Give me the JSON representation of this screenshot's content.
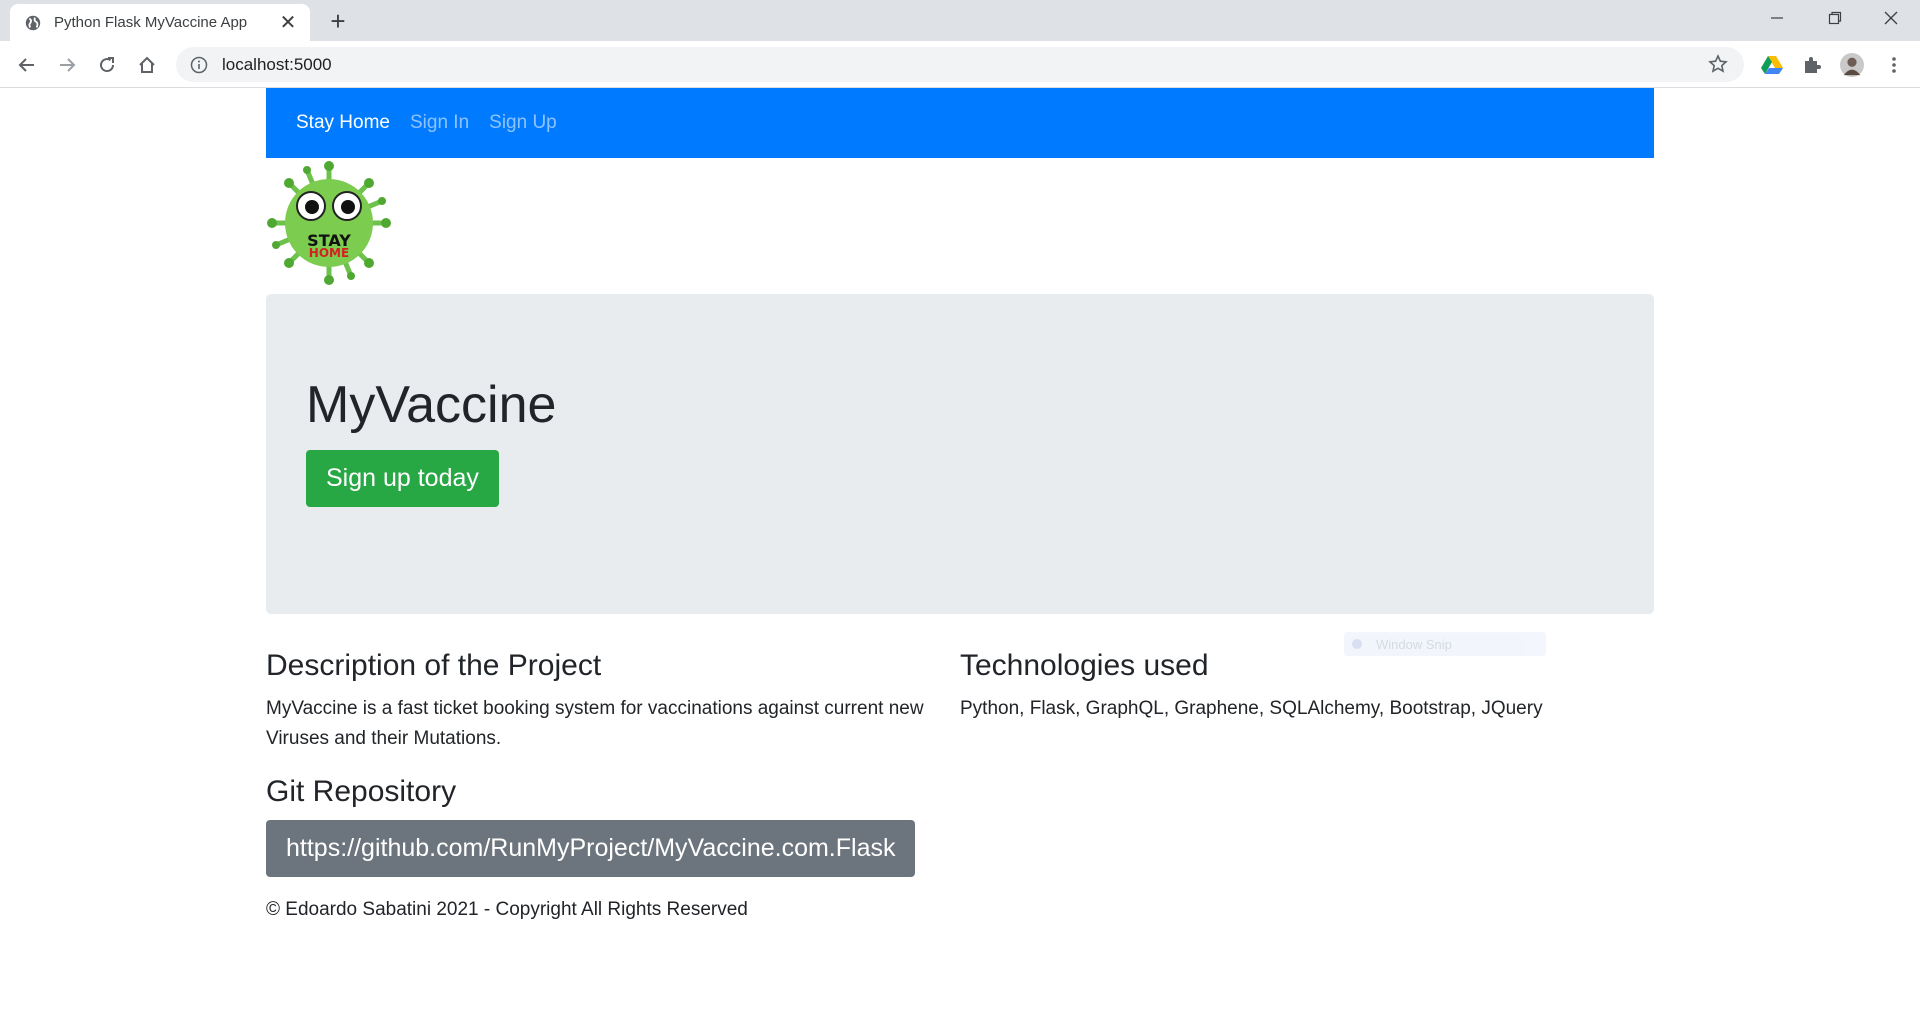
{
  "browser": {
    "tab_title": "Python Flask MyVaccine App",
    "tab_close": "✕",
    "new_tab": "+",
    "url": "localhost:5000",
    "win_minimize": "—",
    "win_close": "✕"
  },
  "navbar": {
    "brand": "Stay Home",
    "links": [
      "Sign In",
      "Sign Up"
    ],
    "color": "#007bff"
  },
  "logo": {
    "text_top": "STAY",
    "text_bottom": "HOME"
  },
  "jumbotron": {
    "title": "MyVaccine",
    "button": "Sign up today"
  },
  "description": {
    "heading": "Description of the Project",
    "text": "MyVaccine is a fast ticket booking system for vaccinations against current new Viruses and their Mutations."
  },
  "git": {
    "heading": "Git Repository",
    "link": "https://github.com/RunMyProject/MyVaccine.com.Flask"
  },
  "technologies": {
    "heading": "Technologies used",
    "text": "Python, Flask, GraphQL, Graphene, SQLAlchemy, Bootstrap, JQuery"
  },
  "footer": "© Edoardo Sabatini 2021 - Copyright All Rights Reserved",
  "overlay": {
    "label": "Window Snip"
  }
}
